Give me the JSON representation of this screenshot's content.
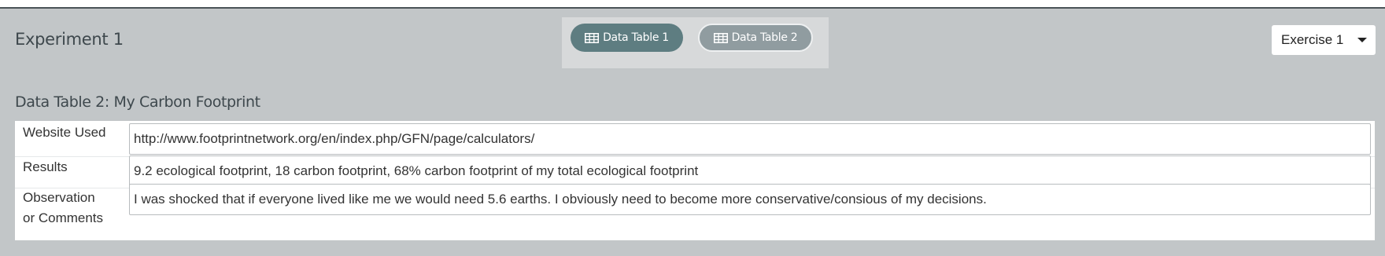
{
  "experiment": {
    "title": "Experiment 1"
  },
  "tabs": [
    {
      "label": "Data Table 1",
      "active": true,
      "icon": "table-icon"
    },
    {
      "label": "Data Table 2",
      "active": false,
      "icon": "table-icon"
    }
  ],
  "exercise_select": {
    "value": "Exercise 1"
  },
  "table": {
    "title": "Data Table 2: My Carbon Footprint",
    "rows": [
      {
        "label": "Website Used",
        "value": "http://www.footprintnetwork.org/en/index.php/GFN/page/calculators/"
      },
      {
        "label": "Results",
        "value": "9.2 ecological footprint, 18 carbon footprint, 68% carbon footprint of my total ecological footprint"
      },
      {
        "label_line1": "Observation",
        "label_line2": "or Comments",
        "value": "I was shocked that if everyone lived like me we would need 5.6 earths. I obviously need to become more conservative/consious of my decisions."
      }
    ]
  },
  "colors": {
    "panel_bg": "#c2c6c8",
    "active_tab": "#5e7d81",
    "inactive_tab": "#909ca0",
    "heading_text": "#3e484d"
  }
}
